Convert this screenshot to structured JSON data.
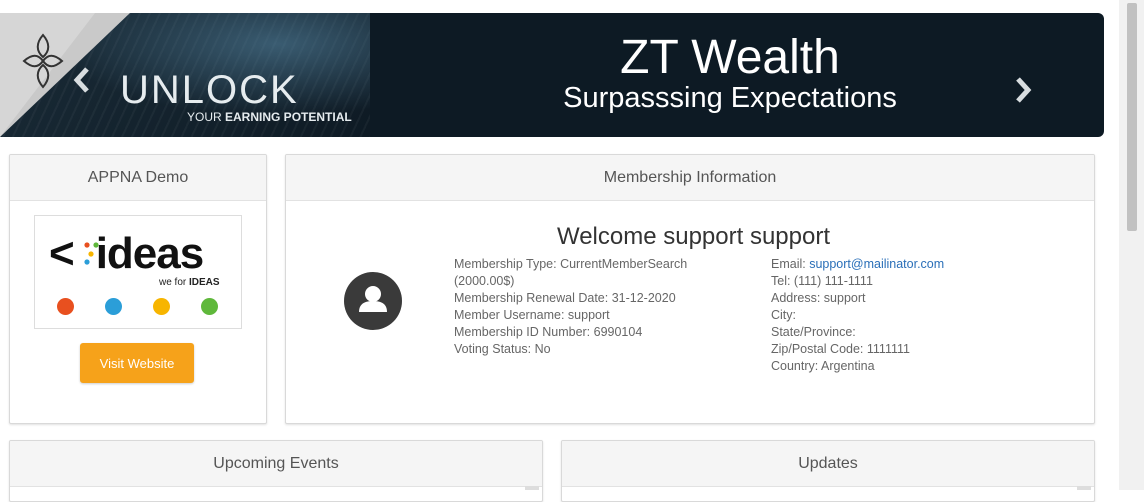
{
  "banner": {
    "left_headline": "UNLOCK",
    "left_subline_prefix": "YOUR",
    "left_subline_bold": "EARNING POTENTIAL",
    "title": "ZT Wealth",
    "subtitle": "Surpasssing Expectations",
    "prev_icon": "chevron-left-icon",
    "next_icon": "chevron-right-icon"
  },
  "appna": {
    "header": "APPNA Demo",
    "logo_word": "ideas",
    "logo_tag_prefix": "we for",
    "logo_tag_bold": "IDEAS",
    "button": "Visit Website",
    "button_color": "#f6a21a",
    "logo_icon_colors": [
      "#e8501f",
      "#2b9ed8",
      "#f7b500",
      "#5fb83b"
    ]
  },
  "membership": {
    "header": "Membership Information",
    "welcome": "Welcome support support",
    "left_lines": [
      "Membership Type: CurrentMemberSearch",
      "(2000.00$)",
      "Membership Renewal Date: 31-12-2020",
      "Member Username: support",
      "Membership ID Number: 6990104",
      "Voting Status: No"
    ],
    "email_label": "Email: ",
    "email_value": "support@mailinator.com",
    "right_lines": [
      "Tel: (111) 111-1111",
      "Address: support",
      "City:",
      "State/Province:",
      "Zip/Postal Code: 1111111",
      "Country: Argentina"
    ]
  },
  "events": {
    "header": "Upcoming Events"
  },
  "updates": {
    "header": "Updates"
  }
}
